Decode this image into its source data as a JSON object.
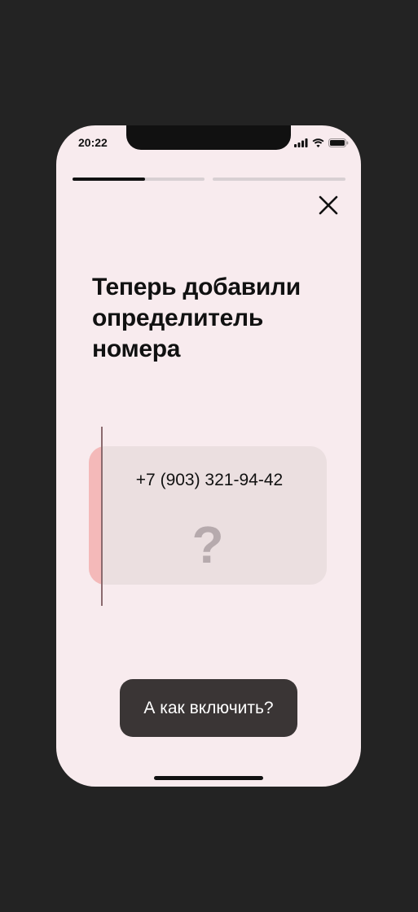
{
  "status_bar": {
    "time": "20:22",
    "icons": [
      "signal-icon",
      "wifi-icon",
      "battery-icon"
    ]
  },
  "progress": {
    "segments": [
      {
        "fill_fraction": 0.55
      },
      {
        "fill_fraction": 0
      }
    ]
  },
  "close_icon": "close-icon",
  "title": "Теперь добавили\nопределитель\nномера",
  "caller_card": {
    "number": "+7 (903) 321-94-42",
    "unknown_symbol": "?"
  },
  "action_button": {
    "label": "А как включить?"
  },
  "colors": {
    "background": "#f8ebee",
    "card": "#ebdfe0",
    "accent_edge": "#f4b9b9",
    "button": "#3a3535"
  }
}
